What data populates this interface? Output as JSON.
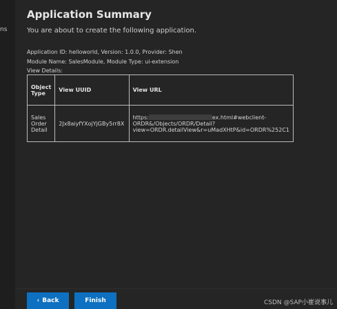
{
  "side": {
    "truncated_label": "ns"
  },
  "header": {
    "title": "Application Summary",
    "subtitle": "You are about to create the following application."
  },
  "info": {
    "line1": "Application ID: helloworld, Version: 1.0.0, Provider: Shen",
    "line2": "Module Name: SalesModule, Module Type: ui-extension",
    "line3": "View Details:"
  },
  "table": {
    "headers": [
      "Object Type",
      "View UUID",
      "View URL"
    ],
    "rows": [
      {
        "object_type": "Sales Order Detail",
        "view_uuid": "2Jx8aiyfYXojYjGBy5rr8X",
        "url_start": "https:",
        "url_tail": "ex.html#webclient-",
        "url_line2": "ORDR&/Objects/ORDR/Detail?",
        "url_line3": "view=ORDR.detailView&r=uMadXHtP&id=ORDR%252C1"
      }
    ]
  },
  "buttons": {
    "back_label": "Back",
    "finish_label": "Finish"
  },
  "watermark": "CSDN @SAP小崔说事儿",
  "colors": {
    "background": "#1e1e1e",
    "panel": "#252526",
    "accent": "#0e70c0"
  }
}
